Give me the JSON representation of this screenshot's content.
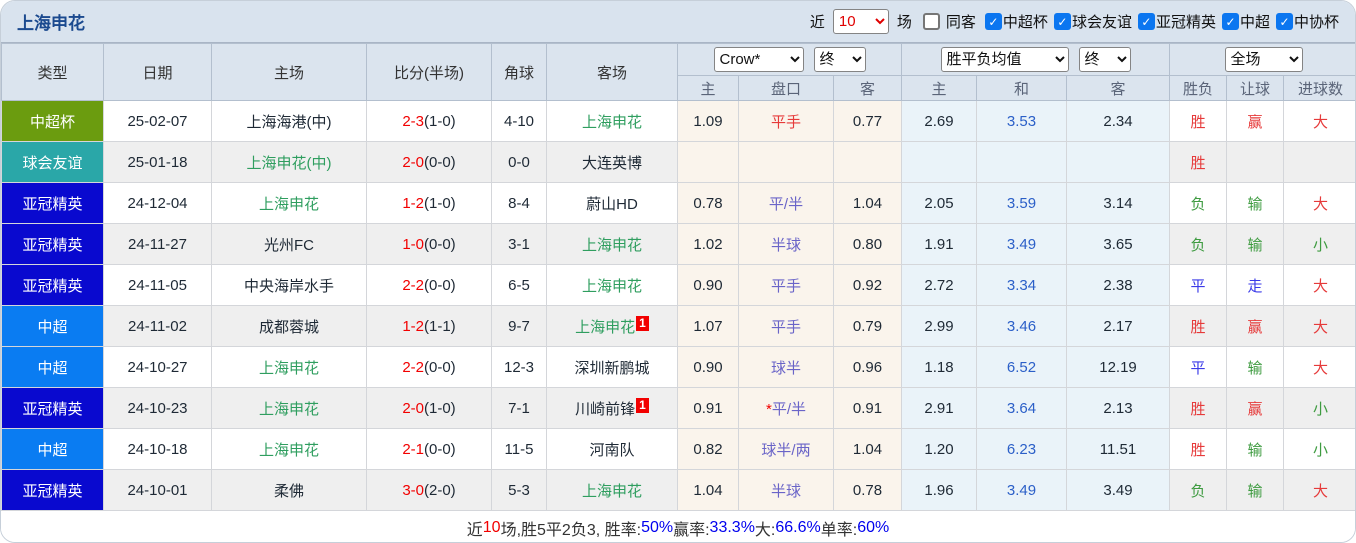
{
  "title": "上海申花",
  "topbar": {
    "recent_label": "近",
    "recent_value": "10",
    "games_label": "场",
    "same_venue": {
      "label": "同客",
      "checked": false
    },
    "leagues": [
      {
        "label": "中超杯",
        "checked": true
      },
      {
        "label": "球会友谊",
        "checked": true
      },
      {
        "label": "亚冠精英",
        "checked": true
      },
      {
        "label": "中超",
        "checked": true
      },
      {
        "label": "中协杯",
        "checked": true
      }
    ]
  },
  "header": {
    "type": "类型",
    "date": "日期",
    "home": "主场",
    "score": "比分(半场)",
    "corner": "角球",
    "away": "客场",
    "odds_company_select": "Crow*",
    "odds_final_select": "终",
    "avg_select": "胜平负均值",
    "avg_final_select": "终",
    "period_select": "全场",
    "sub": {
      "h": "主",
      "handicap": "盘口",
      "a": "客",
      "avg_h": "主",
      "avg_d": "和",
      "avg_a": "客",
      "wl": "胜负",
      "rq": "让球",
      "goals": "进球数"
    }
  },
  "colors": {
    "type_zhongchaobei": "#6b9c0f",
    "type_qiuhuiyouyi": "#2aa7a8",
    "type_yaguanjingying": "#0909cf",
    "type_zhongchao": "#0a7cf2",
    "accent_title": "#1b4a8f",
    "checkbox_checked": "#0b76f0",
    "score_red": "#f20000",
    "team_green": "#2f9e5f"
  },
  "rows": [
    {
      "type": "中超杯",
      "type_color": "#6b9c0f",
      "date": "25-02-07",
      "home": "上海海港(中)",
      "home_green": false,
      "score_main": "2-3",
      "score_half": "(1-0)",
      "corner": "4-10",
      "away": "上海申花",
      "away_green": true,
      "away_badge": "",
      "h1": "1.09",
      "handicap_star": "",
      "handicap": "平手",
      "handicap_color": "red",
      "a1": "0.77",
      "avg_h": "2.69",
      "avg_d": "3.53",
      "avg_a": "2.34",
      "wl": "胜",
      "wl_c": "red",
      "rq": "赢",
      "rq_c": "red",
      "goals": "大",
      "goals_c": "red"
    },
    {
      "type": "球会友谊",
      "type_color": "#2aa7a8",
      "date": "25-01-18",
      "home": "上海申花(中)",
      "home_green": true,
      "score_main": "2-0",
      "score_half": "(0-0)",
      "corner": "0-0",
      "away": "大连英博",
      "away_green": false,
      "away_badge": "",
      "h1": "",
      "handicap_star": "",
      "handicap": "",
      "handicap_color": "purple",
      "a1": "",
      "avg_h": "",
      "avg_d": "",
      "avg_a": "",
      "wl": "胜",
      "wl_c": "red",
      "rq": "",
      "rq_c": "green",
      "goals": "",
      "goals_c": "red"
    },
    {
      "type": "亚冠精英",
      "type_color": "#0909cf",
      "date": "24-12-04",
      "home": "上海申花",
      "home_green": true,
      "score_main": "1-2",
      "score_half": "(1-0)",
      "corner": "8-4",
      "away": "蔚山HD",
      "away_green": false,
      "away_badge": "",
      "h1": "0.78",
      "handicap_star": "",
      "handicap": "平/半",
      "handicap_color": "purple",
      "a1": "1.04",
      "avg_h": "2.05",
      "avg_d": "3.59",
      "avg_a": "3.14",
      "wl": "负",
      "wl_c": "green",
      "rq": "输",
      "rq_c": "green",
      "goals": "大",
      "goals_c": "red"
    },
    {
      "type": "亚冠精英",
      "type_color": "#0909cf",
      "date": "24-11-27",
      "home": "光州FC",
      "home_green": false,
      "score_main": "1-0",
      "score_half": "(0-0)",
      "corner": "3-1",
      "away": "上海申花",
      "away_green": true,
      "away_badge": "",
      "h1": "1.02",
      "handicap_star": "",
      "handicap": "半球",
      "handicap_color": "purple",
      "a1": "0.80",
      "avg_h": "1.91",
      "avg_d": "3.49",
      "avg_a": "3.65",
      "wl": "负",
      "wl_c": "green",
      "rq": "输",
      "rq_c": "green",
      "goals": "小",
      "goals_c": "green"
    },
    {
      "type": "亚冠精英",
      "type_color": "#0909cf",
      "date": "24-11-05",
      "home": "中央海岸水手",
      "home_green": false,
      "score_main": "2-2",
      "score_half": "(0-0)",
      "corner": "6-5",
      "away": "上海申花",
      "away_green": true,
      "away_badge": "",
      "h1": "0.90",
      "handicap_star": "",
      "handicap": "平手",
      "handicap_color": "purple",
      "a1": "0.92",
      "avg_h": "2.72",
      "avg_d": "3.34",
      "avg_a": "2.38",
      "wl": "平",
      "wl_c": "blue",
      "rq": "走",
      "rq_c": "blue",
      "goals": "大",
      "goals_c": "red"
    },
    {
      "type": "中超",
      "type_color": "#0a7cf2",
      "date": "24-11-02",
      "home": "成都蓉城",
      "home_green": false,
      "score_main": "1-2",
      "score_half": "(1-1)",
      "corner": "9-7",
      "away": "上海申花",
      "away_green": true,
      "away_badge": "1",
      "h1": "1.07",
      "handicap_star": "",
      "handicap": "平手",
      "handicap_color": "purple",
      "a1": "0.79",
      "avg_h": "2.99",
      "avg_d": "3.46",
      "avg_a": "2.17",
      "wl": "胜",
      "wl_c": "red",
      "rq": "赢",
      "rq_c": "red",
      "goals": "大",
      "goals_c": "red"
    },
    {
      "type": "中超",
      "type_color": "#0a7cf2",
      "date": "24-10-27",
      "home": "上海申花",
      "home_green": true,
      "score_main": "2-2",
      "score_half": "(0-0)",
      "corner": "12-3",
      "away": "深圳新鹏城",
      "away_green": false,
      "away_badge": "",
      "h1": "0.90",
      "handicap_star": "",
      "handicap": "球半",
      "handicap_color": "purple",
      "a1": "0.96",
      "avg_h": "1.18",
      "avg_d": "6.52",
      "avg_a": "12.19",
      "wl": "平",
      "wl_c": "blue",
      "rq": "输",
      "rq_c": "green",
      "goals": "大",
      "goals_c": "red"
    },
    {
      "type": "亚冠精英",
      "type_color": "#0909cf",
      "date": "24-10-23",
      "home": "上海申花",
      "home_green": true,
      "score_main": "2-0",
      "score_half": "(1-0)",
      "corner": "7-1",
      "away": "川崎前锋",
      "away_green": false,
      "away_badge": "1",
      "h1": "0.91",
      "handicap_star": "*",
      "handicap": "平/半",
      "handicap_color": "purple",
      "a1": "0.91",
      "avg_h": "2.91",
      "avg_d": "3.64",
      "avg_a": "2.13",
      "wl": "胜",
      "wl_c": "red",
      "rq": "赢",
      "rq_c": "red",
      "goals": "小",
      "goals_c": "green"
    },
    {
      "type": "中超",
      "type_color": "#0a7cf2",
      "date": "24-10-18",
      "home": "上海申花",
      "home_green": true,
      "score_main": "2-1",
      "score_half": "(0-0)",
      "corner": "11-5",
      "away": "河南队",
      "away_green": false,
      "away_badge": "",
      "h1": "0.82",
      "handicap_star": "",
      "handicap": "球半/两",
      "handicap_color": "purple",
      "a1": "1.04",
      "avg_h": "1.20",
      "avg_d": "6.23",
      "avg_a": "11.51",
      "wl": "胜",
      "wl_c": "red",
      "rq": "输",
      "rq_c": "green",
      "goals": "小",
      "goals_c": "green"
    },
    {
      "type": "亚冠精英",
      "type_color": "#0909cf",
      "date": "24-10-01",
      "home": "柔佛",
      "home_green": false,
      "score_main": "3-0",
      "score_half": "(2-0)",
      "corner": "5-3",
      "away": "上海申花",
      "away_green": true,
      "away_badge": "",
      "h1": "1.04",
      "handicap_star": "",
      "handicap": "半球",
      "handicap_color": "purple",
      "a1": "0.78",
      "avg_h": "1.96",
      "avg_d": "3.49",
      "avg_a": "3.49",
      "wl": "负",
      "wl_c": "green",
      "rq": "输",
      "rq_c": "green",
      "goals": "大",
      "goals_c": "red"
    }
  ],
  "footer": {
    "segments": [
      {
        "text": "近",
        "color": "black"
      },
      {
        "text": "10",
        "color": "red"
      },
      {
        "text": "场,胜5平2负3, 胜率:",
        "color": "black"
      },
      {
        "text": "50%",
        "color": "blue"
      },
      {
        "text": " 赢率:",
        "color": "black"
      },
      {
        "text": "33.3%",
        "color": "blue"
      },
      {
        "text": " 大:",
        "color": "black"
      },
      {
        "text": "66.6%",
        "color": "blue"
      },
      {
        "text": " 单率:",
        "color": "black"
      },
      {
        "text": "60%",
        "color": "blue"
      }
    ]
  }
}
